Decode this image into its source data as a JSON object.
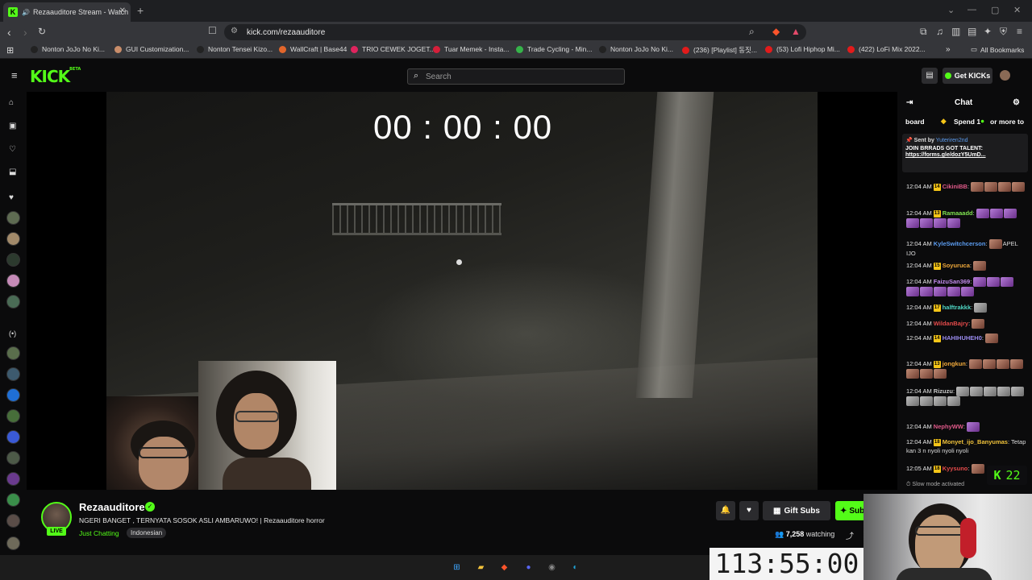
{
  "browser": {
    "tab_title": "Rezaauditore Stream - Watch",
    "tab_close": "✕",
    "new_tab": "+",
    "url": "kick.com/rezaauditore",
    "window_controls": [
      "⌄",
      "—",
      "▢",
      "✕"
    ]
  },
  "bookmarks": [
    {
      "label": "Nonton JoJo No Ki...",
      "color": "#222222"
    },
    {
      "label": "GUI Customization...",
      "color": "#c98d6a"
    },
    {
      "label": "Nonton Tensei Kizo...",
      "color": "#222222"
    },
    {
      "label": "WallCraft | Base44",
      "color": "#e2662b"
    },
    {
      "label": "TRIO CEWEK JOGET...",
      "color": "#e0245e"
    },
    {
      "label": "Tuar Memek - Insta...",
      "color": "#d61f3a"
    },
    {
      "label": "Trade Cycling - Min...",
      "color": "#36b34a"
    },
    {
      "label": "Nonton JoJo No Ki...",
      "color": "#222222"
    },
    {
      "label": "(236) [Playlist] 동짓...",
      "color": "#e21b1b"
    },
    {
      "label": "(53) Lofi Hiphop Mi...",
      "color": "#e21b1b"
    },
    {
      "label": "(422) LoFi Mix 2022...",
      "color": "#e21b1b"
    }
  ],
  "bookmarks_more": "»",
  "all_bookmarks": "All Bookmarks",
  "kick": {
    "logo": "KICK",
    "logo_beta": "BETA",
    "search_placeholder": "Search",
    "get_kicks": "Get KICKs"
  },
  "video": {
    "overlay_timer": "00 : 00 : 00"
  },
  "channel": {
    "name": "Rezaauditore",
    "live_badge": "LIVE",
    "title": "NGERI BANGET , TERNYATA SOSOK ASLI AMBARUWO! | Rezaauditore horror",
    "category": "Just Chatting",
    "tag": "Indonesian",
    "gift_subs": "Gift Subs",
    "subscribe": "Subscribe",
    "viewers": "7,258",
    "watching_label": "watching"
  },
  "chat": {
    "title": "Chat",
    "leaderboard_prefix": "board",
    "leaderboard_text": "Spend 1",
    "leaderboard_suffix": "or more to",
    "pinned_sent_by": "Sent by",
    "pinned_user": "Yuteriren2nd",
    "pinned_message": "JOIN BRRADS GOT TALENT:",
    "pinned_link": "https://forms.gle/dozY5UmD...",
    "messages": [
      {
        "time": "12:04 AM",
        "badge": "14",
        "user": "CikiniBB",
        "color": "#e05a8a",
        "text": ""
      },
      {
        "time": "12:04 AM",
        "badge": "13",
        "user": "Ramaaadd",
        "color": "#7ee04f",
        "text": ""
      },
      {
        "time": "12:04 AM",
        "badge": "",
        "user": "KyleSwitchcerson",
        "color": "#5b9cf0",
        "text": "APEL IJO"
      },
      {
        "time": "12:04 AM",
        "badge": "15",
        "user": "Soyuruca",
        "color": "#f0a93b",
        "text": ""
      },
      {
        "time": "12:04 AM",
        "badge": "",
        "user": "FaizuSan369",
        "color": "#c48cf0",
        "text": ""
      },
      {
        "time": "12:04 AM",
        "badge": "17",
        "user": "halftrakkk",
        "color": "#4fd6c4",
        "text": ""
      },
      {
        "time": "12:04 AM",
        "badge": "",
        "user": "WildanBajry",
        "color": "#e34a4a",
        "text": ""
      },
      {
        "time": "12:04 AM",
        "badge": "14",
        "user": "HAHIHUHEH0",
        "color": "#9b8cf0",
        "text": ""
      },
      {
        "time": "12:04 AM",
        "badge": "13",
        "user": "jongkun",
        "color": "#f0a93b",
        "text": ""
      },
      {
        "time": "12:04 AM",
        "badge": "",
        "user": "Rizuzu",
        "color": "#c8c8c8",
        "text": ""
      },
      {
        "time": "12:04 AM",
        "badge": "",
        "user": "NephyWW",
        "color": "#e05a8a",
        "text": ""
      },
      {
        "time": "12:04 AM",
        "badge": "18",
        "user": "Monyet_ijo_Banyumas",
        "color": "#f0c23b",
        "text": "Tetap kan 3 n nyoli nyoli nyoli"
      },
      {
        "time": "12:05 AM",
        "badge": "18",
        "user": "Kyysuno",
        "color": "#e34a4a",
        "text": ""
      }
    ],
    "slow_mode": "Slow mode activated",
    "kick_count": "22"
  },
  "overlays": {
    "big_timer": "113:55:00"
  },
  "taskbar": [
    {
      "name": "windows-start-icon",
      "glyph": "⊞",
      "color": "#3ea6ff"
    },
    {
      "name": "file-explorer-icon",
      "glyph": "▰",
      "color": "#f3c33c"
    },
    {
      "name": "brave-browser-icon",
      "glyph": "◆",
      "color": "#fb542b"
    },
    {
      "name": "discord-icon",
      "glyph": "●",
      "color": "#5865f2"
    },
    {
      "name": "chrome-icon",
      "glyph": "◉",
      "color": "#888888"
    },
    {
      "name": "edge-icon",
      "glyph": "◐",
      "color": "#1fa3d6"
    }
  ],
  "colors": {
    "kick_green": "#53fc18",
    "background": "#0b0b0c"
  }
}
